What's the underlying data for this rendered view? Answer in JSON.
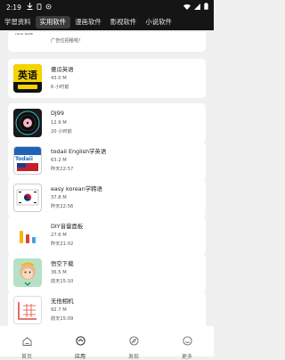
{
  "status": {
    "time": "2:19"
  },
  "tabs": [
    {
      "label": "学習资料",
      "active": false
    },
    {
      "label": "实用软件",
      "active": true
    },
    {
      "label": "漫画软件",
      "active": false
    },
    {
      "label": "影视软件",
      "active": false
    },
    {
      "label": "小说软件",
      "active": false
    }
  ],
  "ad": {
    "logo_text": "LOGO NAME",
    "text": "广告位招租啦！"
  },
  "apps": [
    {
      "name": "傻瓜英语",
      "size": "43.0 M",
      "time": "6 小时前",
      "icon": "english-app-icon",
      "icon_text": "英语"
    },
    {
      "name": "DJ99",
      "size": "12.9 M",
      "time": "20 小时前",
      "icon": "dj-record-icon"
    },
    {
      "name": "todaii English学英语",
      "size": "63.2 M",
      "time": "昨天22:57",
      "icon": "todaii-english-icon",
      "icon_text": "Todaii"
    },
    {
      "name": "easy korean学韩语",
      "size": "37.8 M",
      "time": "昨天22:56",
      "icon": "korean-flag-icon"
    },
    {
      "name": "DIY音量面板",
      "size": "27.6 M",
      "time": "昨天21:02",
      "icon": "volume-bars-icon"
    },
    {
      "name": "悟空下载",
      "size": "36.5 M",
      "time": "前天15:10",
      "icon": "wukong-download-icon"
    },
    {
      "name": "无他相机",
      "size": "92.7 M",
      "time": "前天15:09",
      "icon": "camera-grid-icon"
    }
  ],
  "nav": [
    {
      "label": "首页",
      "icon": "home-icon",
      "active": false
    },
    {
      "label": "应用",
      "icon": "apps-icon",
      "active": true
    },
    {
      "label": "发现",
      "icon": "compass-icon",
      "active": false
    },
    {
      "label": "更多",
      "icon": "profile-icon",
      "active": false
    }
  ],
  "colors": {
    "topbar": "#151515",
    "background": "#f0f0f0",
    "card": "#ffffff",
    "accent_yellow": "#f5d400"
  }
}
